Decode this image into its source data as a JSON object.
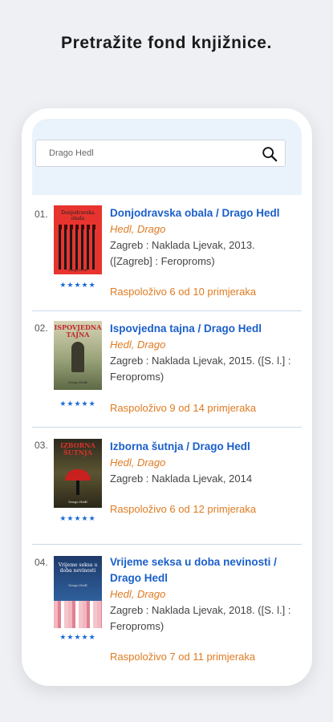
{
  "headline": "Pretražite fond knjižnice.",
  "search": {
    "value": "Drago Hedl"
  },
  "books": [
    {
      "num": "01.",
      "title": "Donjodravska obala / Drago Hedl",
      "author": "Hedl, Drago",
      "publisher": "Zagreb : Naklada Ljevak, 2013. ([Zagreb] : Feroproms)",
      "availability": "Raspoloživo 6 od 10 primjeraka",
      "stars": "★★★★★",
      "cover_title": "Donjodravska obala",
      "cover_author": "Drago Hedl"
    },
    {
      "num": "02.",
      "title": "Ispovjedna tajna / Drago Hedl",
      "author": "Hedl, Drago",
      "publisher": "Zagreb : Naklada Ljevak, 2015. ([S. l.] : Feroproms)",
      "availability": "Raspoloživo 9 od 14 primjeraka",
      "stars": "★★★★★",
      "cover_title": "ISPOVJEDNA TAJNA",
      "cover_author": "Drago Hedl"
    },
    {
      "num": "03.",
      "title": "Izborna šutnja / Drago Hedl",
      "author": "Hedl, Drago",
      "publisher": "Zagreb : Naklada Ljevak, 2014",
      "availability": "Raspoloživo 6 od 12 primjeraka",
      "stars": "★★★★★",
      "cover_title": "IZBORNA ŠUTNJA",
      "cover_author": "Drago Hedl"
    },
    {
      "num": "04.",
      "title": "Vrijeme seksa u doba nevinosti / Drago Hedl",
      "author": "Hedl, Drago",
      "publisher": "Zagreb : Naklada Ljevak, 2018. ([S. l.] : Feroproms)",
      "availability": "Raspoloživo 7 od 11 primjeraka",
      "stars": "★★★★★",
      "cover_title": "Vrijeme seksa u doba nevinosti",
      "cover_author": "Drago Hedl"
    }
  ]
}
